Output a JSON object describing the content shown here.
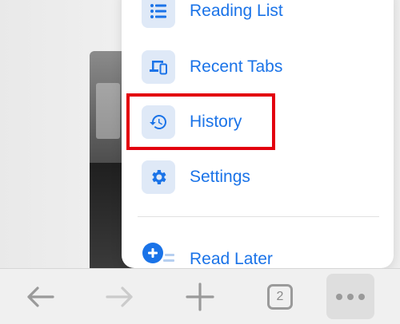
{
  "menu": {
    "items": [
      {
        "label": "Reading List",
        "icon": "list-icon"
      },
      {
        "label": "Recent Tabs",
        "icon": "devices-icon"
      },
      {
        "label": "History",
        "icon": "history-icon"
      },
      {
        "label": "Settings",
        "icon": "gear-icon"
      },
      {
        "label": "Read Later",
        "icon": "add-reading-list-icon"
      }
    ]
  },
  "toolbar": {
    "tab_count": "2",
    "buttons": [
      "back-arrow-icon",
      "forward-arrow-icon",
      "plus-icon",
      "tab-count-icon",
      "more-icon"
    ]
  },
  "colors": {
    "accent": "#1a73e8",
    "icon_bg": "#dfe9f7",
    "highlight": "#e3000f",
    "toolbar_icon": "#9a9a9a"
  }
}
